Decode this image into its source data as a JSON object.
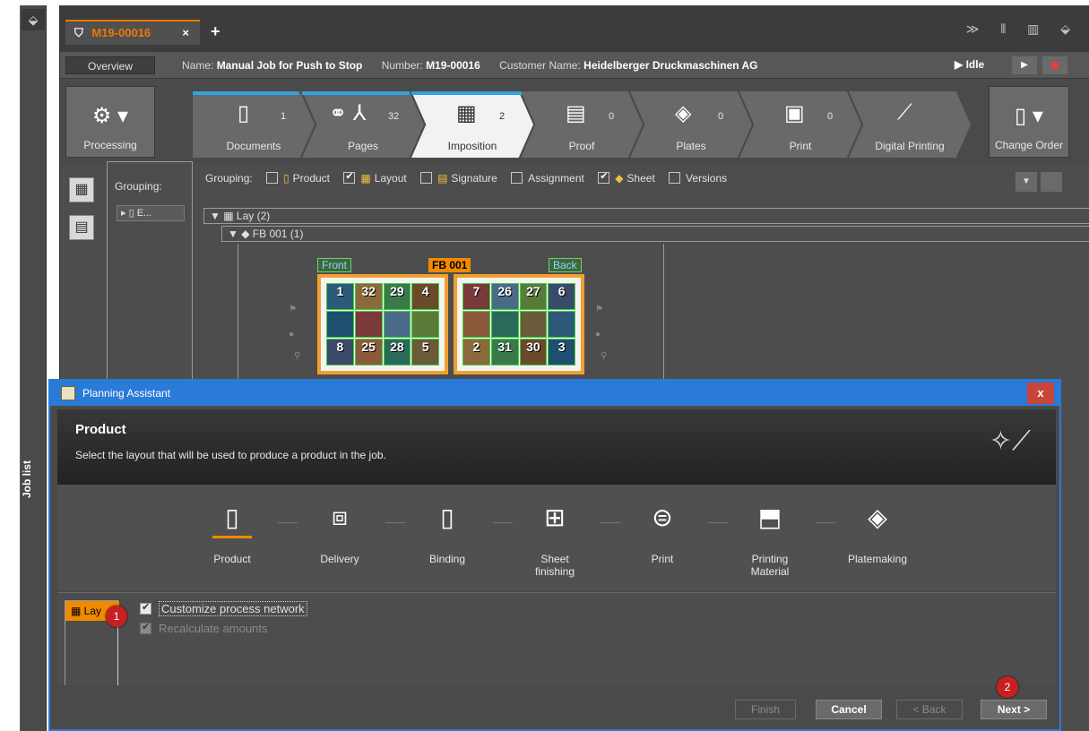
{
  "joblist": {
    "label": "Job list"
  },
  "tabs": {
    "active_label": "M19-00016",
    "close": "×",
    "add": "+"
  },
  "infobar": {
    "overview": "Overview",
    "name_label": "Name:",
    "name_value": "Manual Job for Push to Stop",
    "number_label": "Number:",
    "number_value": "M19-00016",
    "customer_label": "Customer Name:",
    "customer_value": "Heidelberger Druckmaschinen AG",
    "status": "Idle"
  },
  "workflow": {
    "processing": "Processing",
    "change_order": "Change Order",
    "steps": [
      {
        "label": "Documents",
        "count": "1"
      },
      {
        "label": "Pages",
        "count": "32"
      },
      {
        "label": "Imposition",
        "count": "2"
      },
      {
        "label": "Proof",
        "count": "0"
      },
      {
        "label": "Plates",
        "count": "0"
      },
      {
        "label": "Print",
        "count": "0"
      },
      {
        "label": "Digital Printing",
        "count": ""
      }
    ]
  },
  "grouping": {
    "left_label": "Grouping:",
    "left_node": "E...",
    "label": "Grouping:",
    "options": [
      {
        "label": "Product",
        "checked": false
      },
      {
        "label": "Layout",
        "checked": true
      },
      {
        "label": "Signature",
        "checked": false
      },
      {
        "label": "Assignment",
        "checked": false
      },
      {
        "label": "Sheet",
        "checked": true
      },
      {
        "label": "Versions",
        "checked": false
      }
    ]
  },
  "tree": {
    "lay": "Lay (2)",
    "fb": "FB 001 (1)"
  },
  "sheet": {
    "front": "Front",
    "back": "Back",
    "name": "FB 001",
    "front_pages": [
      "1",
      "32",
      "29",
      "4",
      "",
      "",
      "",
      "",
      "8",
      "25",
      "28",
      "5"
    ],
    "back_pages": [
      "7",
      "26",
      "27",
      "6",
      "",
      "",
      "",
      "",
      "2",
      "31",
      "30",
      "3"
    ]
  },
  "modal": {
    "title": "Planning Assistant",
    "close": "x",
    "heading": "Product",
    "description": "Select the layout that will be used to produce a product in the job.",
    "steps": [
      {
        "label": "Product"
      },
      {
        "label": "Delivery"
      },
      {
        "label": "Binding"
      },
      {
        "label": "Sheet finishing"
      },
      {
        "label": "Print"
      },
      {
        "label": "Printing Material"
      },
      {
        "label": "Platemaking"
      }
    ],
    "layout_item": "Lay",
    "customize": "Customize process network",
    "recalculate": "Recalculate amounts",
    "buttons": {
      "finish": "Finish",
      "cancel": "Cancel",
      "back": "< Back",
      "next": "Next >"
    }
  },
  "badges": {
    "one": "1",
    "two": "2"
  },
  "colors": {
    "accent": "#f08a00",
    "dialog_blue": "#2a7ad8",
    "badge_red": "#c82020"
  }
}
